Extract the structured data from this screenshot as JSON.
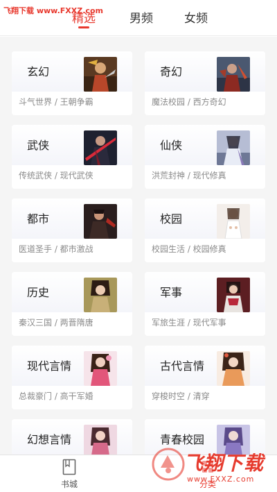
{
  "watermark": {
    "top_text": "飞翔下载 www.FXXZ.com",
    "logo_text": "飞翔下载",
    "logo_url": "www.FXXZ.com"
  },
  "tabs": [
    {
      "label": "精选",
      "active": true
    },
    {
      "label": "男频",
      "active": false
    },
    {
      "label": "女频",
      "active": false
    }
  ],
  "categories": [
    {
      "title": "玄幻",
      "subtitle": "斗气世界 / 王朝争霸",
      "thumb": "warrior-portrait"
    },
    {
      "title": "奇幻",
      "subtitle": "魔法校园 / 西方奇幻",
      "thumb": "fantasy-hero-portrait"
    },
    {
      "title": "武侠",
      "subtitle": "传统武侠 / 现代武侠",
      "thumb": "swordsman-portrait"
    },
    {
      "title": "仙侠",
      "subtitle": "洪荒封神 / 现代修真",
      "thumb": "immortal-portrait"
    },
    {
      "title": "都市",
      "subtitle": "医道圣手 / 都市激战",
      "thumb": "city-hero-portrait"
    },
    {
      "title": "校园",
      "subtitle": "校园生活 / 校园修真",
      "thumb": "student-portrait"
    },
    {
      "title": "历史",
      "subtitle": "秦汉三国 / 两晋隋唐",
      "thumb": "historical-lady-portrait"
    },
    {
      "title": "军事",
      "subtitle": "军旅生涯 / 现代军事",
      "thumb": "military-portrait"
    },
    {
      "title": "现代言情",
      "subtitle": "总裁豪门 / 高干军婚",
      "thumb": "modern-lady-portrait"
    },
    {
      "title": "古代言情",
      "subtitle": "穿梭时空 / 清穿",
      "thumb": "ancient-lady-portrait"
    },
    {
      "title": "幻想言情",
      "subtitle": "",
      "thumb": "fantasy-lady-portrait"
    },
    {
      "title": "青春校园",
      "subtitle": "",
      "thumb": "youth-portrait"
    }
  ],
  "bottom_nav": [
    {
      "label": "书城",
      "icon": "book-icon",
      "active": false
    },
    {
      "label": "分类",
      "icon": "category-icon",
      "active": true
    }
  ],
  "colors": {
    "accent": "#e8382d",
    "background": "#f5f5f5"
  }
}
